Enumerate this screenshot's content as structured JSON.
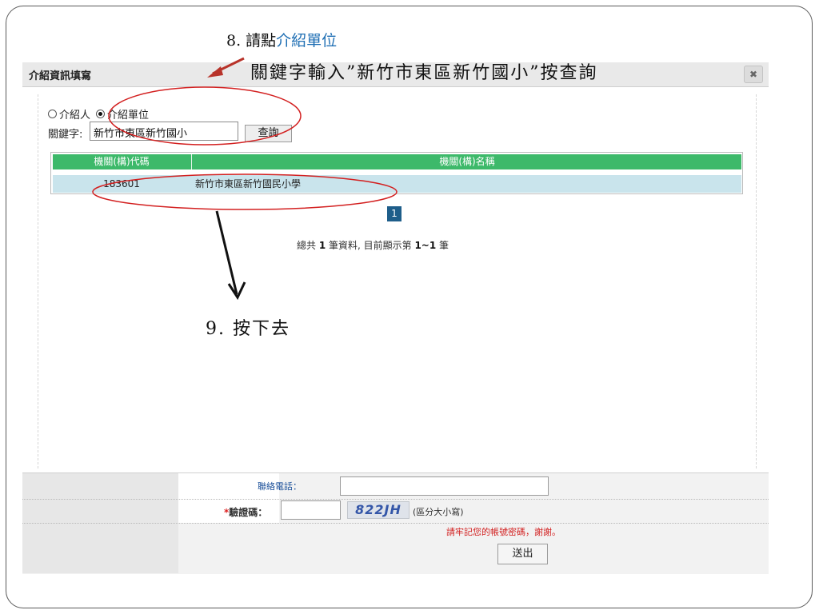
{
  "annotations": {
    "step8_prefix": "8. 請點",
    "step8_highlight": "介紹單位",
    "step8_line2": "關鍵字輸入”新竹市東區新竹國小”按查詢",
    "step9": "9. 按下去"
  },
  "dialog": {
    "title": "介紹資訊填寫",
    "close_icon": "close-icon",
    "radio_options": [
      {
        "label": "介紹人",
        "selected": false
      },
      {
        "label": "介紹單位",
        "selected": true
      }
    ],
    "keyword_label": "關鍵字:",
    "keyword_value": "新竹市東區新竹國小",
    "search_button": "查詢",
    "table": {
      "headers": [
        "機關(構)代碼",
        "機關(構)名稱"
      ],
      "rows": [
        {
          "code": "183601",
          "name": "新竹市東區新竹國民小學"
        }
      ]
    },
    "pagination": {
      "current_page": "1"
    },
    "summary": {
      "prefix": "總共 ",
      "total": "1",
      "middle": " 筆資料, 目前顯示第 ",
      "range": "1~1",
      "suffix": " 筆"
    }
  },
  "form": {
    "phone_label": "聯絡電話：",
    "captcha_required_mark": "*",
    "captcha_label": "驗證碼：",
    "captcha_text": "822JH",
    "captcha_hint": "(區分大小寫)",
    "remember_notice": "請牢記您的帳號密碼，謝謝。",
    "submit_button": "送出"
  },
  "colors": {
    "table_header": "#3db96a",
    "table_row": "#c9e4ec",
    "annotation_red": "#d32020",
    "annotation_blue": "#1f6fb4"
  }
}
